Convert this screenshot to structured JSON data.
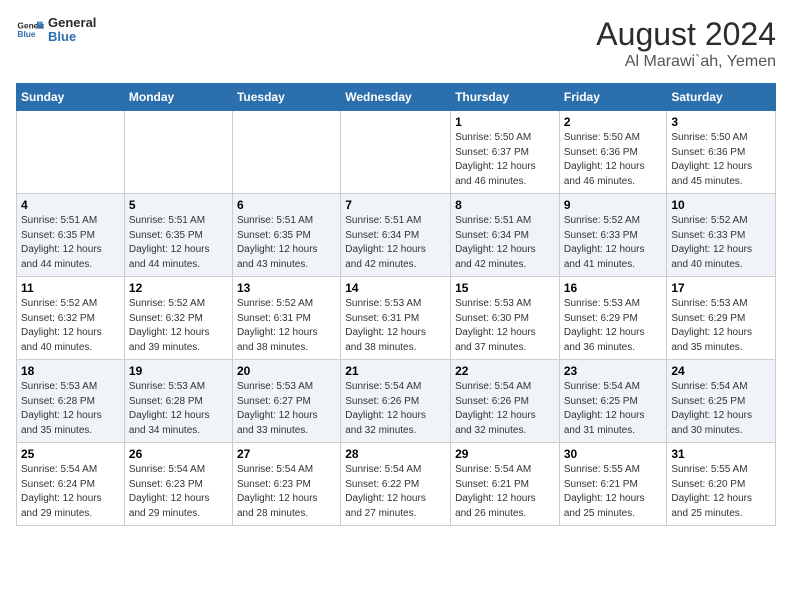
{
  "logo": {
    "line1": "General",
    "line2": "Blue"
  },
  "title": "August 2024",
  "subtitle": "Al Marawi`ah, Yemen",
  "weekdays": [
    "Sunday",
    "Monday",
    "Tuesday",
    "Wednesday",
    "Thursday",
    "Friday",
    "Saturday"
  ],
  "weeks": [
    [
      {
        "day": "",
        "info": ""
      },
      {
        "day": "",
        "info": ""
      },
      {
        "day": "",
        "info": ""
      },
      {
        "day": "",
        "info": ""
      },
      {
        "day": "1",
        "info": "Sunrise: 5:50 AM\nSunset: 6:37 PM\nDaylight: 12 hours\nand 46 minutes."
      },
      {
        "day": "2",
        "info": "Sunrise: 5:50 AM\nSunset: 6:36 PM\nDaylight: 12 hours\nand 46 minutes."
      },
      {
        "day": "3",
        "info": "Sunrise: 5:50 AM\nSunset: 6:36 PM\nDaylight: 12 hours\nand 45 minutes."
      }
    ],
    [
      {
        "day": "4",
        "info": "Sunrise: 5:51 AM\nSunset: 6:35 PM\nDaylight: 12 hours\nand 44 minutes."
      },
      {
        "day": "5",
        "info": "Sunrise: 5:51 AM\nSunset: 6:35 PM\nDaylight: 12 hours\nand 44 minutes."
      },
      {
        "day": "6",
        "info": "Sunrise: 5:51 AM\nSunset: 6:35 PM\nDaylight: 12 hours\nand 43 minutes."
      },
      {
        "day": "7",
        "info": "Sunrise: 5:51 AM\nSunset: 6:34 PM\nDaylight: 12 hours\nand 42 minutes."
      },
      {
        "day": "8",
        "info": "Sunrise: 5:51 AM\nSunset: 6:34 PM\nDaylight: 12 hours\nand 42 minutes."
      },
      {
        "day": "9",
        "info": "Sunrise: 5:52 AM\nSunset: 6:33 PM\nDaylight: 12 hours\nand 41 minutes."
      },
      {
        "day": "10",
        "info": "Sunrise: 5:52 AM\nSunset: 6:33 PM\nDaylight: 12 hours\nand 40 minutes."
      }
    ],
    [
      {
        "day": "11",
        "info": "Sunrise: 5:52 AM\nSunset: 6:32 PM\nDaylight: 12 hours\nand 40 minutes."
      },
      {
        "day": "12",
        "info": "Sunrise: 5:52 AM\nSunset: 6:32 PM\nDaylight: 12 hours\nand 39 minutes."
      },
      {
        "day": "13",
        "info": "Sunrise: 5:52 AM\nSunset: 6:31 PM\nDaylight: 12 hours\nand 38 minutes."
      },
      {
        "day": "14",
        "info": "Sunrise: 5:53 AM\nSunset: 6:31 PM\nDaylight: 12 hours\nand 38 minutes."
      },
      {
        "day": "15",
        "info": "Sunrise: 5:53 AM\nSunset: 6:30 PM\nDaylight: 12 hours\nand 37 minutes."
      },
      {
        "day": "16",
        "info": "Sunrise: 5:53 AM\nSunset: 6:29 PM\nDaylight: 12 hours\nand 36 minutes."
      },
      {
        "day": "17",
        "info": "Sunrise: 5:53 AM\nSunset: 6:29 PM\nDaylight: 12 hours\nand 35 minutes."
      }
    ],
    [
      {
        "day": "18",
        "info": "Sunrise: 5:53 AM\nSunset: 6:28 PM\nDaylight: 12 hours\nand 35 minutes."
      },
      {
        "day": "19",
        "info": "Sunrise: 5:53 AM\nSunset: 6:28 PM\nDaylight: 12 hours\nand 34 minutes."
      },
      {
        "day": "20",
        "info": "Sunrise: 5:53 AM\nSunset: 6:27 PM\nDaylight: 12 hours\nand 33 minutes."
      },
      {
        "day": "21",
        "info": "Sunrise: 5:54 AM\nSunset: 6:26 PM\nDaylight: 12 hours\nand 32 minutes."
      },
      {
        "day": "22",
        "info": "Sunrise: 5:54 AM\nSunset: 6:26 PM\nDaylight: 12 hours\nand 32 minutes."
      },
      {
        "day": "23",
        "info": "Sunrise: 5:54 AM\nSunset: 6:25 PM\nDaylight: 12 hours\nand 31 minutes."
      },
      {
        "day": "24",
        "info": "Sunrise: 5:54 AM\nSunset: 6:25 PM\nDaylight: 12 hours\nand 30 minutes."
      }
    ],
    [
      {
        "day": "25",
        "info": "Sunrise: 5:54 AM\nSunset: 6:24 PM\nDaylight: 12 hours\nand 29 minutes."
      },
      {
        "day": "26",
        "info": "Sunrise: 5:54 AM\nSunset: 6:23 PM\nDaylight: 12 hours\nand 29 minutes."
      },
      {
        "day": "27",
        "info": "Sunrise: 5:54 AM\nSunset: 6:23 PM\nDaylight: 12 hours\nand 28 minutes."
      },
      {
        "day": "28",
        "info": "Sunrise: 5:54 AM\nSunset: 6:22 PM\nDaylight: 12 hours\nand 27 minutes."
      },
      {
        "day": "29",
        "info": "Sunrise: 5:54 AM\nSunset: 6:21 PM\nDaylight: 12 hours\nand 26 minutes."
      },
      {
        "day": "30",
        "info": "Sunrise: 5:55 AM\nSunset: 6:21 PM\nDaylight: 12 hours\nand 25 minutes."
      },
      {
        "day": "31",
        "info": "Sunrise: 5:55 AM\nSunset: 6:20 PM\nDaylight: 12 hours\nand 25 minutes."
      }
    ]
  ]
}
